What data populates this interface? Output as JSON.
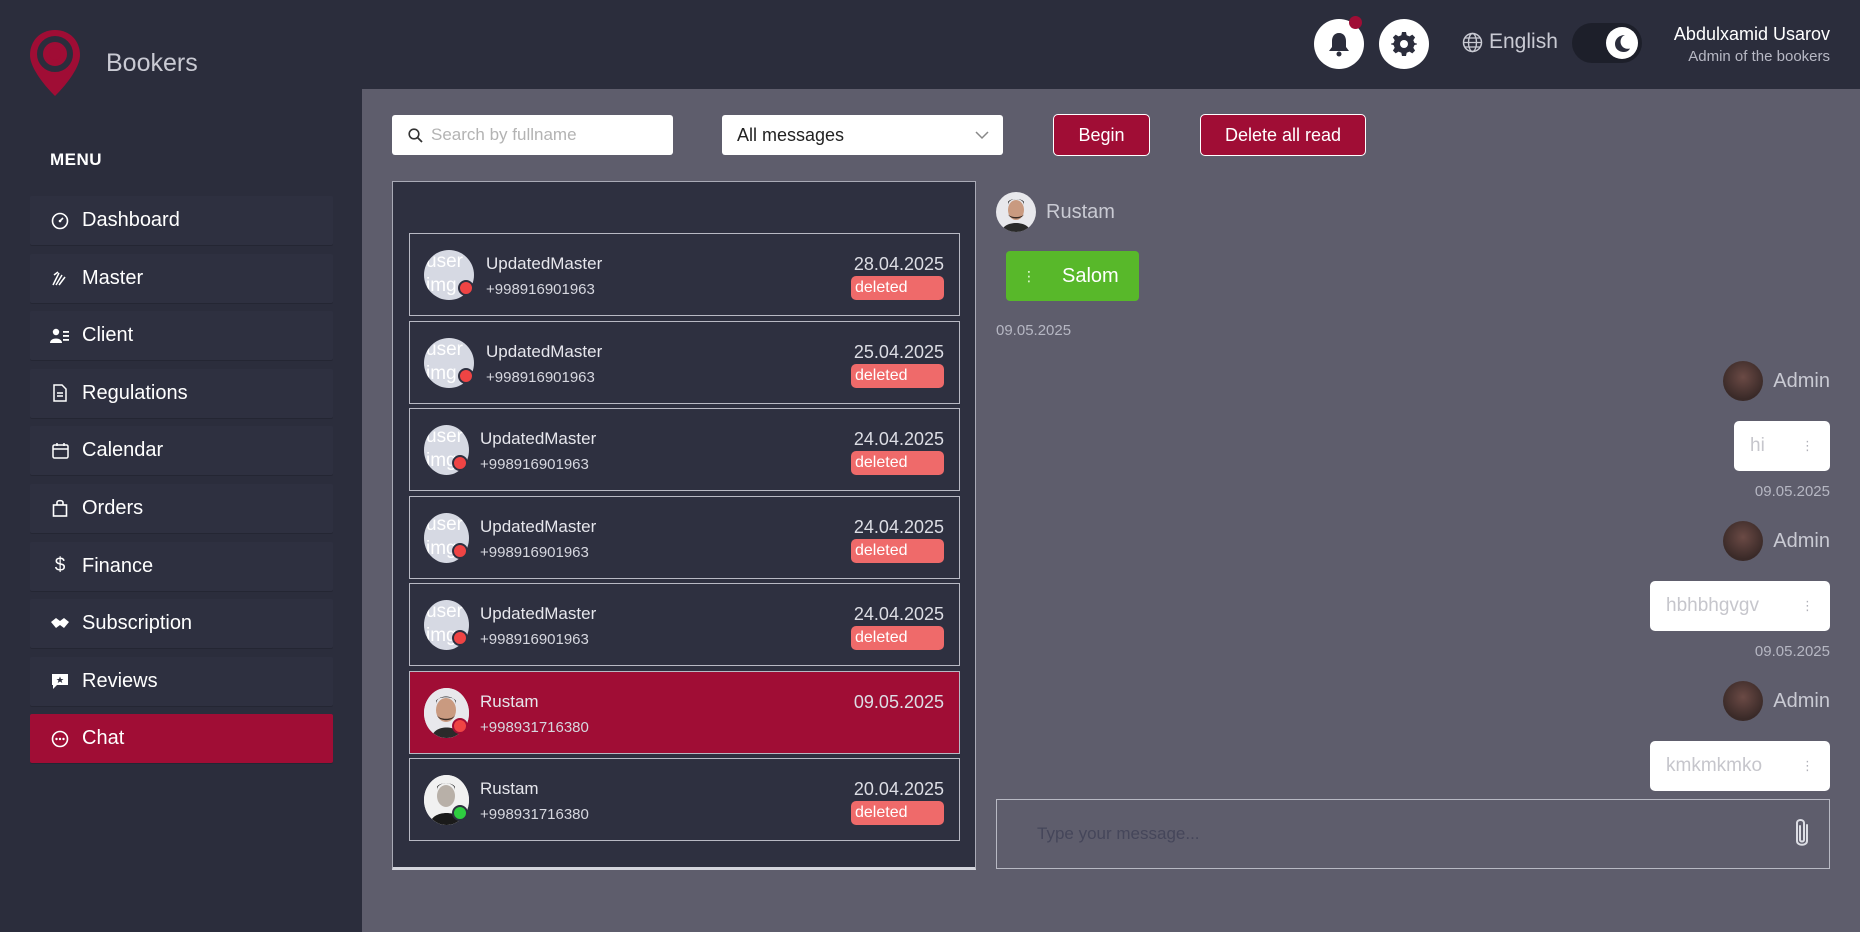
{
  "brand": {
    "name": "Bookers"
  },
  "menu": {
    "title": "MENU",
    "items": [
      {
        "label": "Dashboard",
        "icon": "dashboard-icon"
      },
      {
        "label": "Master",
        "icon": "master-icon"
      },
      {
        "label": "Client",
        "icon": "client-icon"
      },
      {
        "label": "Regulations",
        "icon": "document-icon"
      },
      {
        "label": "Calendar",
        "icon": "calendar-icon"
      },
      {
        "label": "Orders",
        "icon": "bag-icon"
      },
      {
        "label": "Finance",
        "icon": "dollar-icon"
      },
      {
        "label": "Subscription",
        "icon": "handshake-icon"
      },
      {
        "label": "Reviews",
        "icon": "review-icon"
      },
      {
        "label": "Chat",
        "icon": "chat-icon",
        "active": true
      }
    ]
  },
  "header": {
    "language": "English",
    "user": {
      "name": "Abdulxamid Usarov",
      "role": "Admin of the bookers"
    }
  },
  "toolbar": {
    "search_placeholder": "Search by fullname",
    "filter_value": "All messages",
    "begin_label": "Begin",
    "delete_label": "Delete all read"
  },
  "conversations": [
    {
      "name": "UpdatedMaster",
      "phone": "+998916901963",
      "date": "28.04.2025",
      "status": "deleted",
      "avatar_alt": "user img",
      "online": false
    },
    {
      "name": "UpdatedMaster",
      "phone": "+998916901963",
      "date": "25.04.2025",
      "status": "deleted",
      "avatar_alt": "user img",
      "online": false
    },
    {
      "name": "UpdatedMaster",
      "phone": "+998916901963",
      "date": "24.04.2025",
      "status": "deleted",
      "avatar_alt": "user img",
      "online": false
    },
    {
      "name": "UpdatedMaster",
      "phone": "+998916901963",
      "date": "24.04.2025",
      "status": "deleted",
      "avatar_alt": "user img",
      "online": false
    },
    {
      "name": "UpdatedMaster",
      "phone": "+998916901963",
      "date": "24.04.2025",
      "status": "deleted",
      "avatar_alt": "user img",
      "online": false
    },
    {
      "name": "Rustam",
      "phone": "+998931716380",
      "date": "09.05.2025",
      "status": "",
      "avatar_alt": "",
      "online": false,
      "active": true
    },
    {
      "name": "Rustam",
      "phone": "+998931716380",
      "date": "20.04.2025",
      "status": "deleted",
      "avatar_alt": "",
      "online": true
    }
  ],
  "chat": {
    "contact_name": "Rustam",
    "incoming": {
      "text": "Salom",
      "time": "09.05.2025"
    },
    "outgoing": [
      {
        "sender": "Admin",
        "text": "hi",
        "time": "09.05.2025"
      },
      {
        "sender": "Admin",
        "text": "hbhbhgvgv",
        "time": "09.05.2025"
      },
      {
        "sender": "Admin",
        "text": "kmkmkmko",
        "time": ""
      }
    ],
    "composer_placeholder": "Type your message..."
  },
  "colors": {
    "accent": "#a00d35",
    "sidebar": "#2b2d3c",
    "content": "#5e5d6c",
    "deleted_badge": "#ef6a6a",
    "incoming_bubble": "#58b82a",
    "online": "#2ecc40",
    "offline": "#ef4444"
  }
}
